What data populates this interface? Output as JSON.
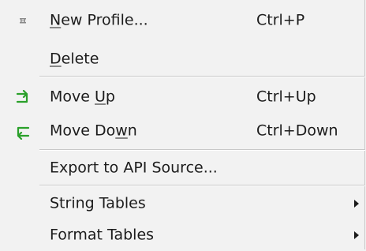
{
  "menu": {
    "new_profile": {
      "before": "",
      "mnemonic": "N",
      "after": "ew Profile...",
      "shortcut": "Ctrl+P",
      "icon": "new-profile-icon"
    },
    "delete": {
      "before": "",
      "mnemonic": "D",
      "after": "elete"
    },
    "move_up": {
      "before": "Move ",
      "mnemonic": "U",
      "after": "p",
      "shortcut": "Ctrl+Up",
      "icon": "move-up-icon"
    },
    "move_down": {
      "before": "Move Do",
      "mnemonic": "w",
      "after": "n",
      "shortcut": "Ctrl+Down",
      "icon": "move-down-icon"
    },
    "export": {
      "label": "Export to API Source..."
    },
    "string_tables": {
      "label": "String Tables"
    },
    "format_tables": {
      "label": "Format Tables"
    }
  },
  "colors": {
    "background": "#f2f2f2",
    "text": "#1c1c1c",
    "icon_green": "#2aa02a",
    "separator": "#c8c8c8"
  }
}
